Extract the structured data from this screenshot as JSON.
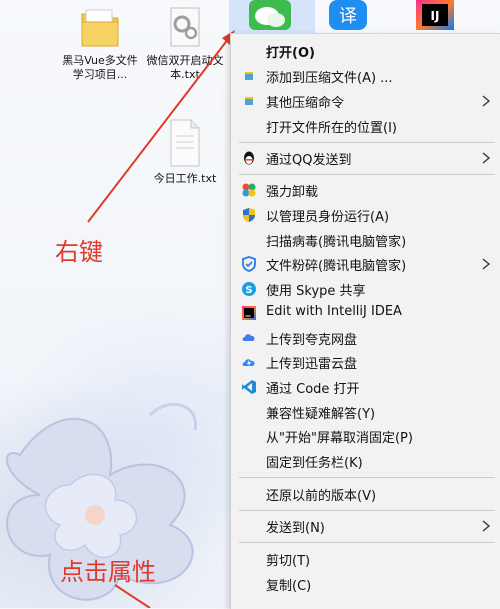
{
  "desktop": {
    "icons": [
      {
        "label": "黑马Vue多文件学习项目..."
      },
      {
        "label": "微信双开启动文本.txt"
      },
      {
        "label": "今日工作.txt"
      }
    ]
  },
  "annotations": {
    "right_click": "右键",
    "click_properties": "点击属性"
  },
  "taskbar_icons": [
    {
      "name": "wechat-icon"
    },
    {
      "name": "translate-icon",
      "text": "译"
    },
    {
      "name": "intellij-icon",
      "text": "IJ"
    }
  ],
  "context_menu": {
    "items": [
      {
        "label": "打开(O)",
        "bold": true,
        "icon": "none"
      },
      {
        "label": "添加到压缩文件(A) ...",
        "icon": "archive-icon"
      },
      {
        "label": "其他压缩命令",
        "icon": "archive-icon",
        "submenu": true
      },
      {
        "label": "打开文件所在的位置(I)",
        "icon": "none"
      },
      {
        "label": "通过QQ发送到",
        "icon": "qq-icon",
        "submenu": true
      },
      {
        "label": "强力卸载",
        "icon": "uninstall-icon"
      },
      {
        "label": "以管理员身份运行(A)",
        "icon": "shield-icon"
      },
      {
        "label": "扫描病毒(腾讯电脑管家)",
        "icon": "none"
      },
      {
        "label": "文件粉碎(腾讯电脑管家)",
        "icon": "shredder-icon",
        "submenu": true
      },
      {
        "label": "使用 Skype 共享",
        "icon": "skype-icon"
      },
      {
        "label": "Edit with IntelliJ IDEA",
        "icon": "intellij-small-icon"
      },
      {
        "label": "上传到夸克网盘",
        "icon": "quark-cloud-icon"
      },
      {
        "label": "上传到迅雷云盘",
        "icon": "xunlei-cloud-icon"
      },
      {
        "label": "通过 Code 打开",
        "icon": "vscode-icon"
      },
      {
        "label": "兼容性疑难解答(Y)",
        "icon": "none"
      },
      {
        "label": "从\"开始\"屏幕取消固定(P)",
        "icon": "none"
      },
      {
        "label": "固定到任务栏(K)",
        "icon": "none"
      },
      {
        "label": "还原以前的版本(V)",
        "icon": "none"
      },
      {
        "label": "发送到(N)",
        "icon": "none",
        "submenu": true
      },
      {
        "label": "剪切(T)",
        "icon": "none"
      },
      {
        "label": "复制(C)",
        "icon": "none"
      }
    ]
  }
}
